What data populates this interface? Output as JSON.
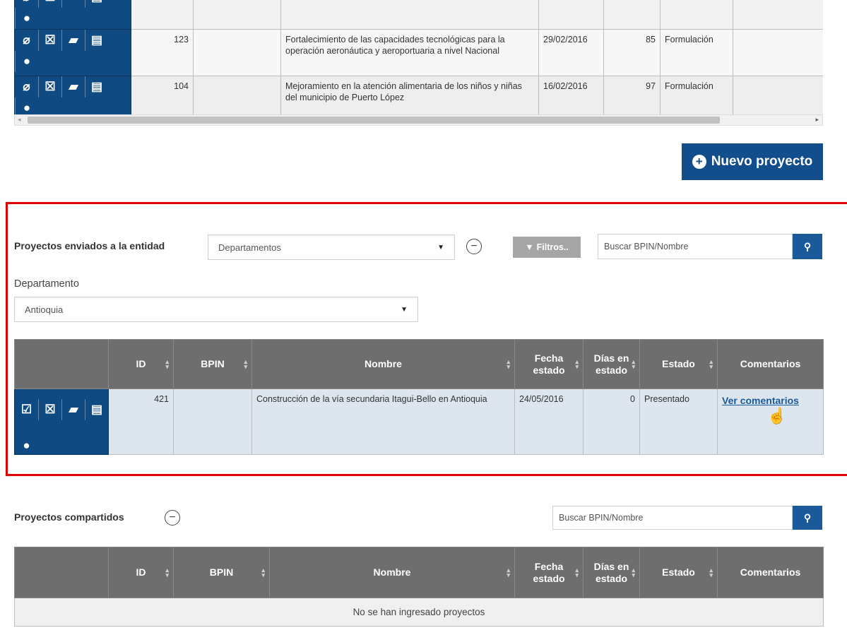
{
  "top_table": {
    "rows": [
      {
        "id": "123",
        "bpin": "",
        "nombre": "Fortalecimiento de las capacidades tecnológicas para la operación aeronáutica y aeroportuaria a nivel Nacional",
        "fecha": "29/02/2016",
        "dias": "85",
        "estado": "Formulación"
      },
      {
        "id": "104",
        "bpin": "",
        "nombre": "Mejoramiento en la atención alimentaria de los niños y niñas del municipio de  Puerto López",
        "fecha": "16/02/2016",
        "dias": "97",
        "estado": "Formulación"
      }
    ]
  },
  "new_project_button": "Nuevo proyecto",
  "enviados": {
    "title": "Proyectos enviados a la entidad",
    "select_value": "Departamentos",
    "filter_label": "Filtros..",
    "search_placeholder": "Buscar BPIN/Nombre",
    "departamento_label": "Departamento",
    "departamento_value": "Antioquia",
    "headers": {
      "id": "ID",
      "bpin": "BPIN",
      "nombre": "Nombre",
      "fecha": "Fecha estado",
      "dias": "Días en estado",
      "estado": "Estado",
      "comentarios": "Comentarios"
    },
    "rows": [
      {
        "id": "421",
        "bpin": "",
        "nombre": "Construcción de la vía secundaria Itagui-Bello en Antioquia",
        "fecha": "24/05/2016",
        "dias": "0",
        "estado": "Presentado",
        "comentarios": "Ver comentarios"
      }
    ]
  },
  "compartidos": {
    "title": "Proyectos compartidos",
    "search_placeholder": "Buscar BPIN/Nombre",
    "headers": {
      "id": "ID",
      "bpin": "BPIN",
      "nombre": "Nombre",
      "fecha": "Fecha estado",
      "dias": "Días en estado",
      "estado": "Estado",
      "comentarios": "Comentarios"
    },
    "empty_message": "No se han ingresado proyectos"
  },
  "colors": {
    "action_blue": "#104a82",
    "header_gray": "#6e6e6e",
    "highlight_red": "#e00000",
    "link_blue": "#1a5a9a"
  }
}
